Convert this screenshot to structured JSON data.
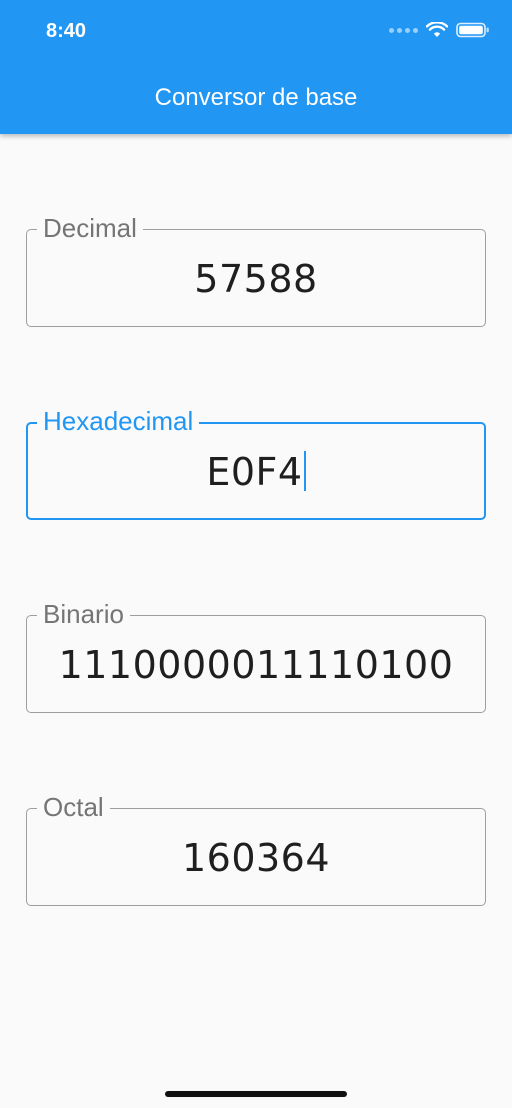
{
  "status_bar": {
    "time": "8:40",
    "icons": [
      "signal-dots-icon",
      "wifi-icon",
      "battery-icon"
    ]
  },
  "app_bar": {
    "title": "Conversor de base",
    "color": "#2196f3"
  },
  "fields": [
    {
      "label": "Decimal",
      "value": "57588",
      "focused": false
    },
    {
      "label": "Hexadecimal",
      "value": "E0F4",
      "focused": true
    },
    {
      "label": "Binario",
      "value": "1110000011110100",
      "focused": false
    },
    {
      "label": "Octal",
      "value": "160364",
      "focused": false
    }
  ],
  "colors": {
    "accent": "#2196f3",
    "background": "#fafafa",
    "border": "#9e9e9e",
    "label": "#757575"
  }
}
